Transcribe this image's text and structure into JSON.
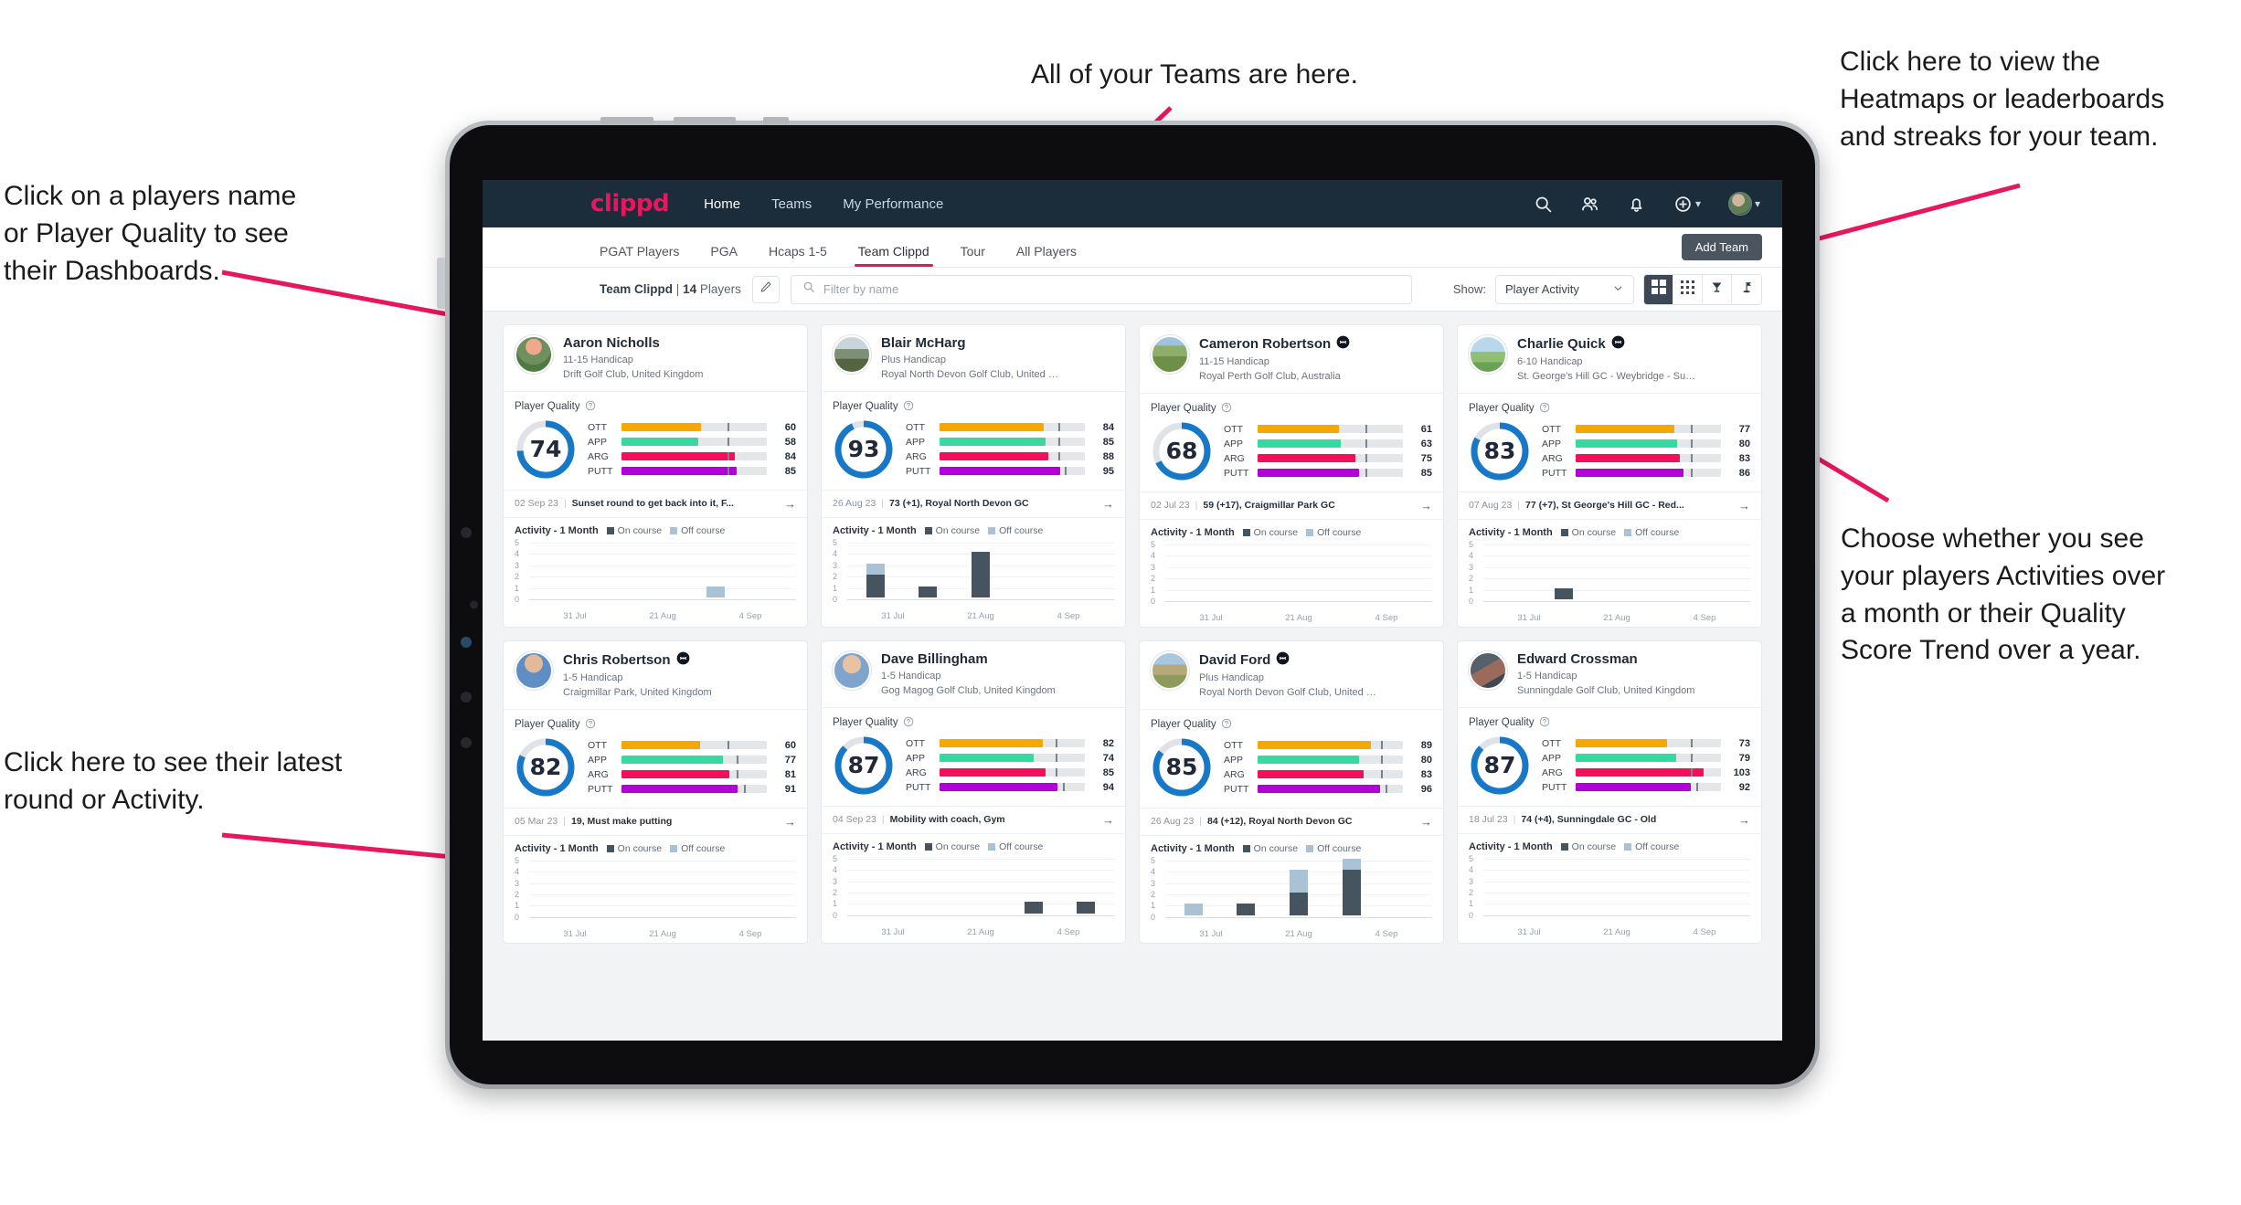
{
  "annotations": [
    {
      "id": "teams-note",
      "text": "All of your Teams are here."
    },
    {
      "id": "heatmaps-note",
      "text": "Click here to view the\nHeatmaps or leaderboards\nand streaks for your team."
    },
    {
      "id": "player-name-note",
      "text": "Click on a players name\nor Player Quality to see\ntheir Dashboards."
    },
    {
      "id": "activity-choice-note",
      "text": "Choose whether you see\nyour players Activities over\na month or their Quality\nScore Trend over a year."
    },
    {
      "id": "latest-round-note",
      "text": "Click here to see their latest\nround or Activity."
    }
  ],
  "navbar": {
    "brand": "clippd",
    "links": [
      {
        "label": "Home",
        "active": true
      },
      {
        "label": "Teams",
        "active": false
      },
      {
        "label": "My Performance",
        "active": false
      }
    ],
    "icons": [
      "search-icon",
      "people-icon",
      "bell-icon",
      "plus-circle-icon",
      "avatar"
    ]
  },
  "tabs": [
    {
      "label": "PGAT Players",
      "active": false
    },
    {
      "label": "PGA",
      "active": false
    },
    {
      "label": "Hcaps 1-5",
      "active": false
    },
    {
      "label": "Team Clippd",
      "active": true
    },
    {
      "label": "Tour",
      "active": false
    },
    {
      "label": "All Players",
      "active": false
    }
  ],
  "add_team_label": "Add Team",
  "filter_bar": {
    "team_name": "Team Clippd",
    "separator": "|",
    "player_count": "14",
    "players_word": "Players",
    "edit_icon": "pencil-icon",
    "search_placeholder": "Filter by name",
    "search_value": "",
    "show_label": "Show:",
    "show_value": "Player Activity",
    "show_options": [
      "Player Activity",
      "Quality Score Trend"
    ],
    "views": [
      {
        "name": "grid-view",
        "icon": "grid-icon",
        "active": true
      },
      {
        "name": "dots-view",
        "icon": "dots-grid-icon",
        "active": false
      },
      {
        "name": "leaderboard-view",
        "icon": "trophy-icon",
        "active": false
      },
      {
        "name": "course-view",
        "icon": "golf-flag-icon",
        "active": false
      }
    ]
  },
  "card_labels": {
    "player_quality": "Player Quality",
    "help_icon": "question-circle-icon",
    "activity_title": "Activity - 1 Month",
    "legend_on": "On course",
    "legend_off": "Off course",
    "arrow_icon": "arrow-right-icon",
    "metrics": [
      "OTT",
      "APP",
      "ARG",
      "PUTT"
    ],
    "y_ticks": [
      "5",
      "4",
      "3",
      "2",
      "1",
      "0"
    ],
    "x_ticks": [
      "31 Jul",
      "21 Aug",
      "4 Sep"
    ]
  },
  "colors": {
    "brand": "#e8175d",
    "navbar": "#1b2c3b",
    "ott": "#f5a800",
    "app": "#38d9a0",
    "arg": "#f50f5a",
    "putt": "#b400d8",
    "donut": "#1878c8",
    "on_course": "#46545f",
    "off_course": "#a9c2d6"
  },
  "players": [
    {
      "name": "Aaron Nicholls",
      "verified": false,
      "handicap": "11-15 Handicap",
      "club": "Drift Golf Club, United Kingdom",
      "quality": 74,
      "metrics": [
        {
          "key": "OTT",
          "value": 60,
          "fill": 55,
          "tick": 73
        },
        {
          "key": "APP",
          "value": 58,
          "fill": 53,
          "tick": 73
        },
        {
          "key": "ARG",
          "value": 84,
          "fill": 78,
          "tick": 73
        },
        {
          "key": "PUTT",
          "value": 85,
          "fill": 79,
          "tick": 73
        }
      ],
      "latest_date": "02 Sep 23",
      "latest_text": "Sunset round to get back into it, F...",
      "activity": [
        {
          "on": 0,
          "off": 0
        },
        {
          "on": 0,
          "off": 0
        },
        {
          "on": 0,
          "off": 0
        },
        {
          "on": 0,
          "off": 1
        },
        {
          "on": 0,
          "off": 0
        }
      ],
      "avatar": "sunset-course"
    },
    {
      "name": "Blair McHarg",
      "verified": false,
      "handicap": "Plus Handicap",
      "club": "Royal North Devon Golf Club, United Kin...",
      "quality": 93,
      "metrics": [
        {
          "key": "OTT",
          "value": 84,
          "fill": 72,
          "tick": 82
        },
        {
          "key": "APP",
          "value": 85,
          "fill": 73,
          "tick": 82
        },
        {
          "key": "ARG",
          "value": 88,
          "fill": 75,
          "tick": 82
        },
        {
          "key": "PUTT",
          "value": 95,
          "fill": 83,
          "tick": 86
        }
      ],
      "latest_date": "26 Aug 23",
      "latest_text": "73 (+1), Royal North Devon GC",
      "activity": [
        {
          "on": 2,
          "off": 1
        },
        {
          "on": 1,
          "off": 0
        },
        {
          "on": 4,
          "off": 0
        },
        {
          "on": 0,
          "off": 0
        },
        {
          "on": 0,
          "off": 0
        }
      ],
      "avatar": "links-statue"
    },
    {
      "name": "Cameron Robertson",
      "verified": true,
      "handicap": "11-15 Handicap",
      "club": "Royal Perth Golf Club, Australia",
      "quality": 68,
      "metrics": [
        {
          "key": "OTT",
          "value": 61,
          "fill": 56,
          "tick": 74
        },
        {
          "key": "APP",
          "value": 63,
          "fill": 57,
          "tick": 74
        },
        {
          "key": "ARG",
          "value": 75,
          "fill": 67,
          "tick": 74
        },
        {
          "key": "PUTT",
          "value": 85,
          "fill": 70,
          "tick": 74
        }
      ],
      "latest_date": "02 Jul 23",
      "latest_text": "59 (+17), Craigmillar Park GC",
      "activity": [
        {
          "on": 0,
          "off": 0
        },
        {
          "on": 0,
          "off": 0
        },
        {
          "on": 0,
          "off": 0
        },
        {
          "on": 0,
          "off": 0
        },
        {
          "on": 0,
          "off": 0
        }
      ],
      "avatar": "fairway-walk"
    },
    {
      "name": "Charlie Quick",
      "verified": true,
      "handicap": "6-10 Handicap",
      "club": "St. George's Hill GC - Weybridge - Surrey, ...",
      "quality": 83,
      "metrics": [
        {
          "key": "OTT",
          "value": 77,
          "fill": 68,
          "tick": 79
        },
        {
          "key": "APP",
          "value": 80,
          "fill": 70,
          "tick": 79
        },
        {
          "key": "ARG",
          "value": 83,
          "fill": 72,
          "tick": 79
        },
        {
          "key": "PUTT",
          "value": 86,
          "fill": 74,
          "tick": 79
        }
      ],
      "latest_date": "07 Aug 23",
      "latest_text": "77 (+7), St George's Hill GC - Red...",
      "activity": [
        {
          "on": 0,
          "off": 0
        },
        {
          "on": 1,
          "off": 0
        },
        {
          "on": 0,
          "off": 0
        },
        {
          "on": 0,
          "off": 0
        },
        {
          "on": 0,
          "off": 0
        }
      ],
      "avatar": "green-sky"
    },
    {
      "name": "Chris Robertson",
      "verified": true,
      "handicap": "1-5 Handicap",
      "club": "Craigmillar Park, United Kingdom",
      "quality": 82,
      "metrics": [
        {
          "key": "OTT",
          "value": 60,
          "fill": 54,
          "tick": 73
        },
        {
          "key": "APP",
          "value": 77,
          "fill": 70,
          "tick": 79
        },
        {
          "key": "ARG",
          "value": 81,
          "fill": 74,
          "tick": 79
        },
        {
          "key": "PUTT",
          "value": 91,
          "fill": 80,
          "tick": 84
        }
      ],
      "latest_date": "05 Mar 23",
      "latest_text": "19, Must make putting",
      "activity": [
        {
          "on": 0,
          "off": 0
        },
        {
          "on": 0,
          "off": 0
        },
        {
          "on": 0,
          "off": 0
        },
        {
          "on": 0,
          "off": 0
        },
        {
          "on": 0,
          "off": 0
        }
      ],
      "avatar": "man-blue-shirt"
    },
    {
      "name": "Dave Billingham",
      "verified": false,
      "handicap": "1-5 Handicap",
      "club": "Gog Magog Golf Club, United Kingdom",
      "quality": 87,
      "metrics": [
        {
          "key": "OTT",
          "value": 82,
          "fill": 71,
          "tick": 80
        },
        {
          "key": "APP",
          "value": 74,
          "fill": 65,
          "tick": 80
        },
        {
          "key": "ARG",
          "value": 85,
          "fill": 73,
          "tick": 80
        },
        {
          "key": "PUTT",
          "value": 94,
          "fill": 81,
          "tick": 85
        }
      ],
      "latest_date": "04 Sep 23",
      "latest_text": "Mobility with coach, Gym",
      "activity": [
        {
          "on": 0,
          "off": 0
        },
        {
          "on": 0,
          "off": 0
        },
        {
          "on": 0,
          "off": 0
        },
        {
          "on": 1,
          "off": 0
        },
        {
          "on": 1,
          "off": 0
        }
      ],
      "avatar": "man-beard"
    },
    {
      "name": "David Ford",
      "verified": true,
      "handicap": "Plus Handicap",
      "club": "Royal North Devon Golf Club, United Kin...",
      "quality": 85,
      "metrics": [
        {
          "key": "OTT",
          "value": 89,
          "fill": 78,
          "tick": 85
        },
        {
          "key": "APP",
          "value": 80,
          "fill": 70,
          "tick": 85
        },
        {
          "key": "ARG",
          "value": 83,
          "fill": 73,
          "tick": 85
        },
        {
          "key": "PUTT",
          "value": 96,
          "fill": 84,
          "tick": 88
        }
      ],
      "latest_date": "26 Aug 23",
      "latest_text": "84 (+12), Royal North Devon GC",
      "activity": [
        {
          "on": 0,
          "off": 1
        },
        {
          "on": 1,
          "off": 0
        },
        {
          "on": 2,
          "off": 2
        },
        {
          "on": 4,
          "off": 1
        },
        {
          "on": 0,
          "off": 0
        }
      ],
      "avatar": "golfer-swing"
    },
    {
      "name": "Edward Crossman",
      "verified": false,
      "handicap": "1-5 Handicap",
      "club": "Sunningdale Golf Club, United Kingdom",
      "quality": 87,
      "metrics": [
        {
          "key": "OTT",
          "value": 73,
          "fill": 63,
          "tick": 79
        },
        {
          "key": "APP",
          "value": 79,
          "fill": 69,
          "tick": 79
        },
        {
          "key": "ARG",
          "value": 103,
          "fill": 88,
          "tick": 79
        },
        {
          "key": "PUTT",
          "value": 92,
          "fill": 79,
          "tick": 83
        }
      ],
      "latest_date": "18 Jul 23",
      "latest_text": "74 (+4), Sunningdale GC - Old",
      "activity": [
        {
          "on": 0,
          "off": 0
        },
        {
          "on": 0,
          "off": 0
        },
        {
          "on": 0,
          "off": 0
        },
        {
          "on": 0,
          "off": 0
        },
        {
          "on": 0,
          "off": 0
        }
      ],
      "avatar": "indoor-photo"
    }
  ]
}
